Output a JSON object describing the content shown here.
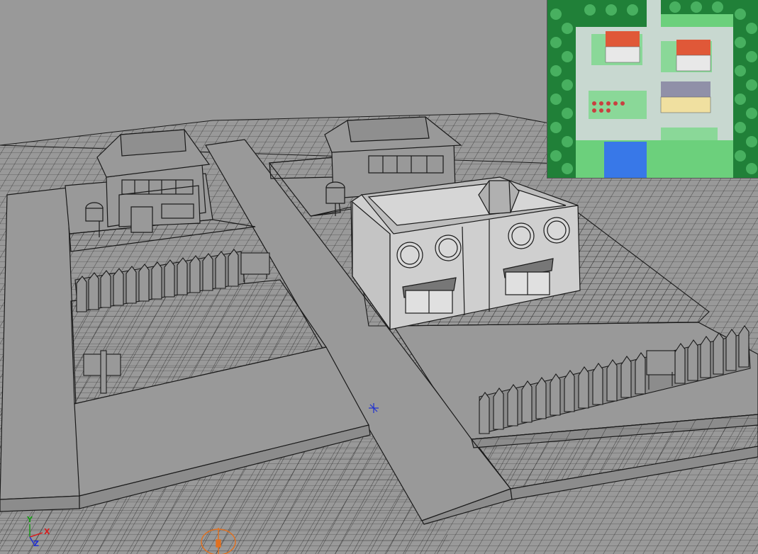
{
  "viewport": {
    "background_color": "#999999",
    "wire_color": "#1a1a1a",
    "shaded_color": "#d0d0d0"
  },
  "axis_gizmo": {
    "x_label": "X",
    "y_label": "Y",
    "z_label": "Z",
    "x_color": "#d42020",
    "y_color": "#1a9a1a",
    "z_color": "#2030d0"
  },
  "pivot": {
    "color": "#2030d0"
  },
  "light_gizmo": {
    "color": "#e07020"
  },
  "minimap": {
    "grass_color": "#6cd07c",
    "path_color": "#c8d8d0",
    "water_color": "#3878e8",
    "roof_color": "#e05838",
    "tree_color": "#208038"
  }
}
